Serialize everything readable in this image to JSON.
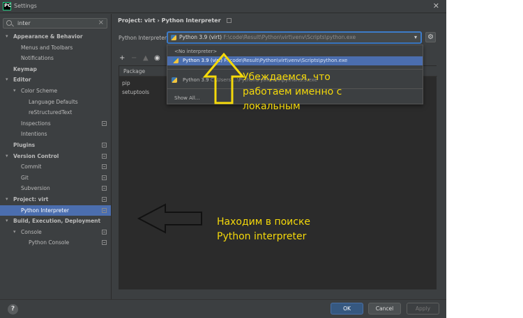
{
  "window": {
    "title": "Settings",
    "logo_text": "PC",
    "close_glyph": "✕"
  },
  "sidebar": {
    "search_value": "inter",
    "items": [
      {
        "label": "Appearance & Behavior",
        "level": 0,
        "expanded": true,
        "bold": true,
        "selected": false,
        "has_config": false
      },
      {
        "label": "Menus and Toolbars",
        "level": 1,
        "expanded": null,
        "bold": false,
        "selected": false,
        "has_config": false
      },
      {
        "label": "Notifications",
        "level": 1,
        "expanded": null,
        "bold": false,
        "selected": false,
        "has_config": false
      },
      {
        "label": "Keymap",
        "level": 0,
        "expanded": null,
        "bold": true,
        "selected": false,
        "has_config": false
      },
      {
        "label": "Editor",
        "level": 0,
        "expanded": true,
        "bold": true,
        "selected": false,
        "has_config": false
      },
      {
        "label": "Color Scheme",
        "level": 1,
        "expanded": true,
        "bold": false,
        "selected": false,
        "has_config": false
      },
      {
        "label": "Language Defaults",
        "level": 2,
        "expanded": null,
        "bold": false,
        "selected": false,
        "has_config": false
      },
      {
        "label": "reStructuredText",
        "level": 2,
        "expanded": null,
        "bold": false,
        "selected": false,
        "has_config": false
      },
      {
        "label": "Inspections",
        "level": 1,
        "expanded": null,
        "bold": false,
        "selected": false,
        "has_config": true
      },
      {
        "label": "Intentions",
        "level": 1,
        "expanded": null,
        "bold": false,
        "selected": false,
        "has_config": false
      },
      {
        "label": "Plugins",
        "level": 0,
        "expanded": null,
        "bold": true,
        "selected": false,
        "has_config": true
      },
      {
        "label": "Version Control",
        "level": 0,
        "expanded": true,
        "bold": true,
        "selected": false,
        "has_config": true
      },
      {
        "label": "Commit",
        "level": 1,
        "expanded": null,
        "bold": false,
        "selected": false,
        "has_config": true
      },
      {
        "label": "Git",
        "level": 1,
        "expanded": null,
        "bold": false,
        "selected": false,
        "has_config": true
      },
      {
        "label": "Subversion",
        "level": 1,
        "expanded": null,
        "bold": false,
        "selected": false,
        "has_config": true
      },
      {
        "label": "Project: virt",
        "level": 0,
        "expanded": true,
        "bold": true,
        "selected": false,
        "has_config": true
      },
      {
        "label": "Python Interpreter",
        "level": 1,
        "expanded": null,
        "bold": false,
        "selected": true,
        "has_config": true
      },
      {
        "label": "Build, Execution, Deployment",
        "level": 0,
        "expanded": true,
        "bold": true,
        "selected": false,
        "has_config": false
      },
      {
        "label": "Console",
        "level": 1,
        "expanded": true,
        "bold": false,
        "selected": false,
        "has_config": true
      },
      {
        "label": "Python Console",
        "level": 2,
        "expanded": null,
        "bold": false,
        "selected": false,
        "has_config": true
      }
    ]
  },
  "main": {
    "breadcrumb_project": "Project: virt",
    "breadcrumb_sep": "›",
    "breadcrumb_page": "Python Interpreter",
    "interpreter_label": "Python Interpreter:",
    "selected_name": "Python 3.9 (virt)",
    "selected_path": "F:\\code\\Result\\Python\\virt\\venv\\Scripts\\python.exe",
    "table_header": "Package",
    "packages": [
      "pip",
      "setuptools"
    ]
  },
  "dropdown": {
    "no_interpreter": "<No interpreter>",
    "option1_name": "Python 3.9 (virt)",
    "option1_path": "F:\\code\\Result\\Python\\virt\\venv\\Scripts\\python.exe",
    "option2_name": "Python 3.9",
    "option2_path": "C:\\Users\\...\\Python\\Python39\\python3.9.exe",
    "show_all": "Show All..."
  },
  "buttons": {
    "help": "?",
    "ok": "OK",
    "cancel": "Cancel",
    "apply": "Apply"
  },
  "annotations": {
    "note_top": [
      "Убеждаемся, что",
      "работаем именно с",
      "локальным"
    ],
    "note_bottom": [
      "Находим в поиске",
      "Python interpreter"
    ]
  },
  "colors": {
    "accent": "#4b6eaf",
    "annotation": "#f5d90a",
    "background": "#3c3f41"
  }
}
